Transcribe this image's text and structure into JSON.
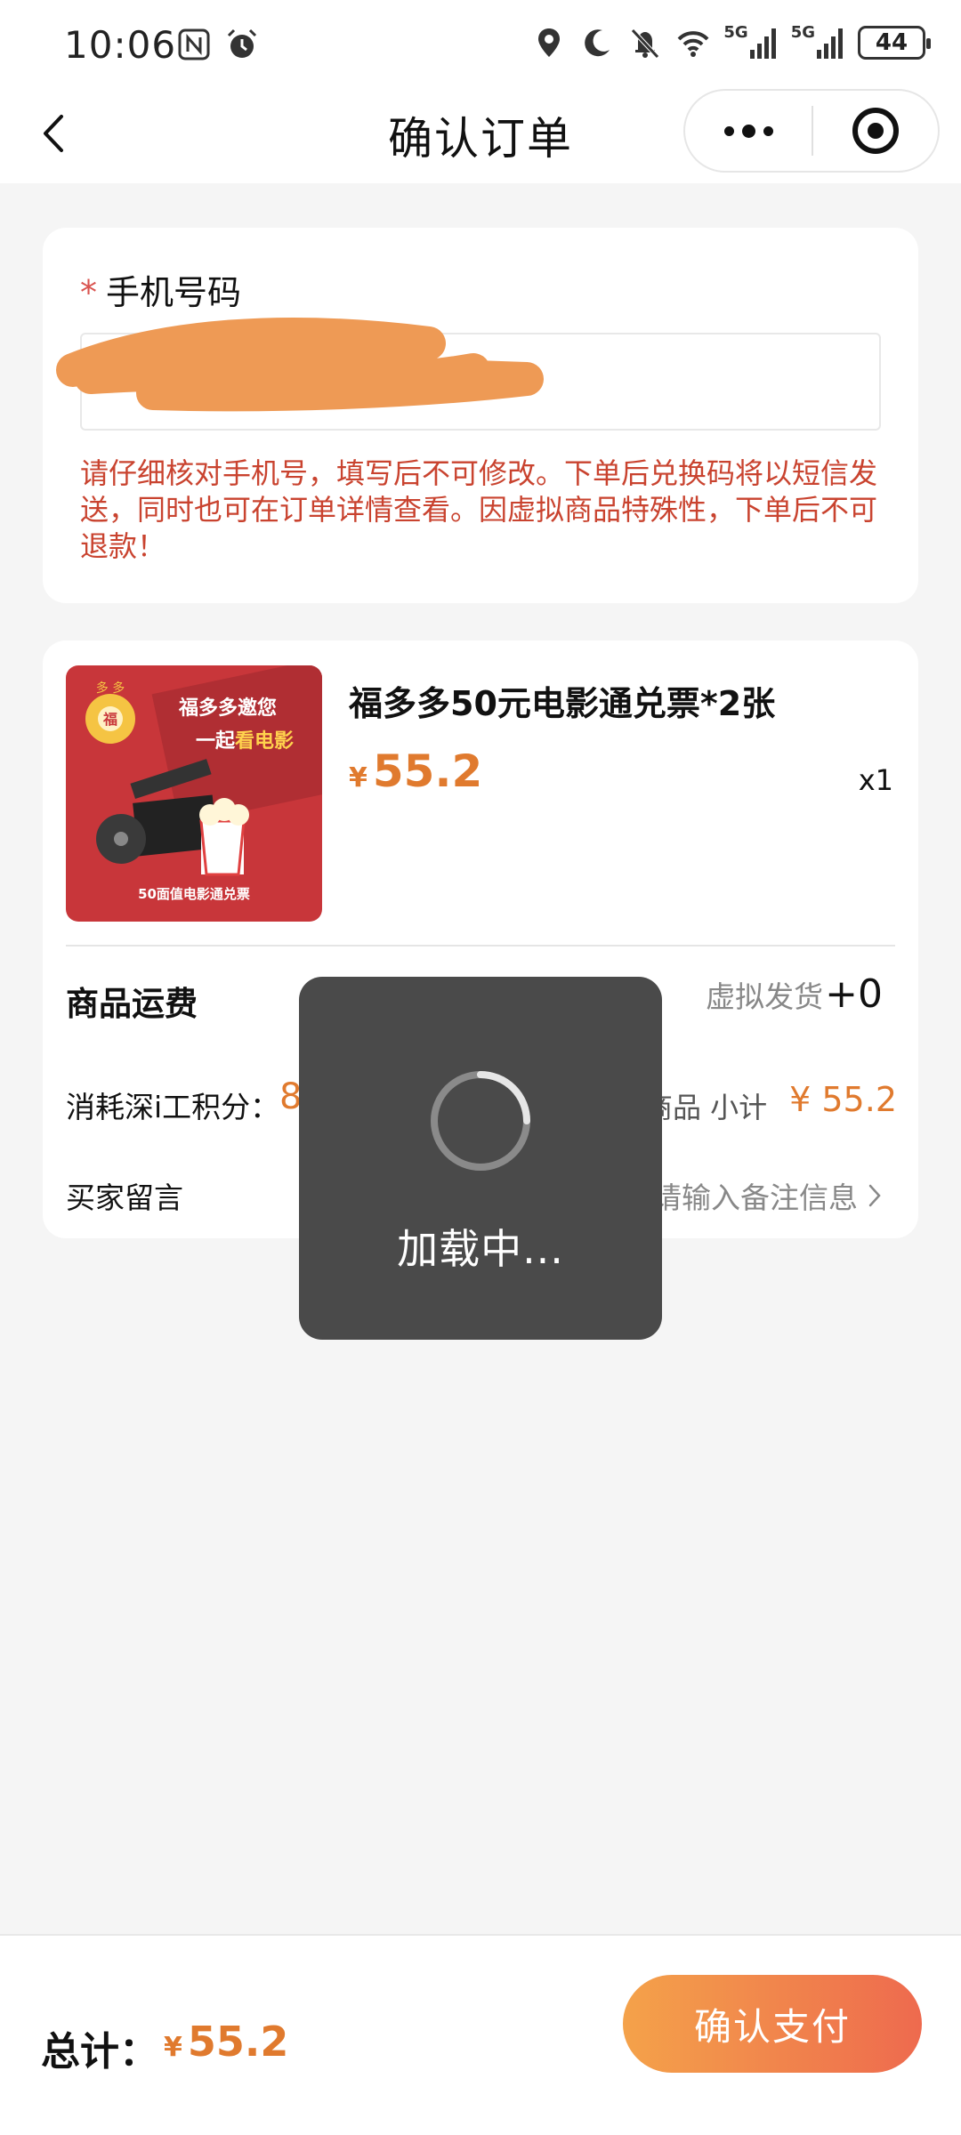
{
  "status_bar": {
    "time": "10:06",
    "signal_label_1": "5G",
    "signal_label_2": "5G",
    "battery": "44"
  },
  "nav": {
    "title": "确认订单"
  },
  "phone_section": {
    "required_mark": "*",
    "label": "手机号码",
    "notice": "请仔细核对手机号，填写后不可修改。下单后兑换码将以短信发送，同时也可在订单详情查看。因虚拟商品特殊性，下单后不可退款！"
  },
  "product": {
    "thumbnail": {
      "brand": "多 多",
      "headline_1": "福多多邀您",
      "headline_2_prefix": "一起",
      "headline_2_highlight": "看电影",
      "footer": "50面值电影通兑票"
    },
    "name": "福多多50元电影通兑票*2张",
    "price_symbol": "¥",
    "price": "55.2",
    "quantity": "x1",
    "shipping_label": "商品运费",
    "shipping_type": "虚拟发货",
    "shipping_fee": "+0",
    "points_label": "消耗深i工积分：",
    "points_value": "8",
    "subtotal_label": "商品 小计",
    "subtotal_value": "¥ 55.2",
    "remark_label": "买家留言",
    "remark_placeholder": "请输入备注信息"
  },
  "loading": {
    "text": "加载中..."
  },
  "footer": {
    "total_label": "总计：",
    "total_symbol": "¥",
    "total_value": "55.2",
    "pay_button": "确认支付"
  },
  "colors": {
    "accent": "#e07a2e",
    "notice": "#c9432f",
    "toast_bg": "#4a4a4a"
  }
}
